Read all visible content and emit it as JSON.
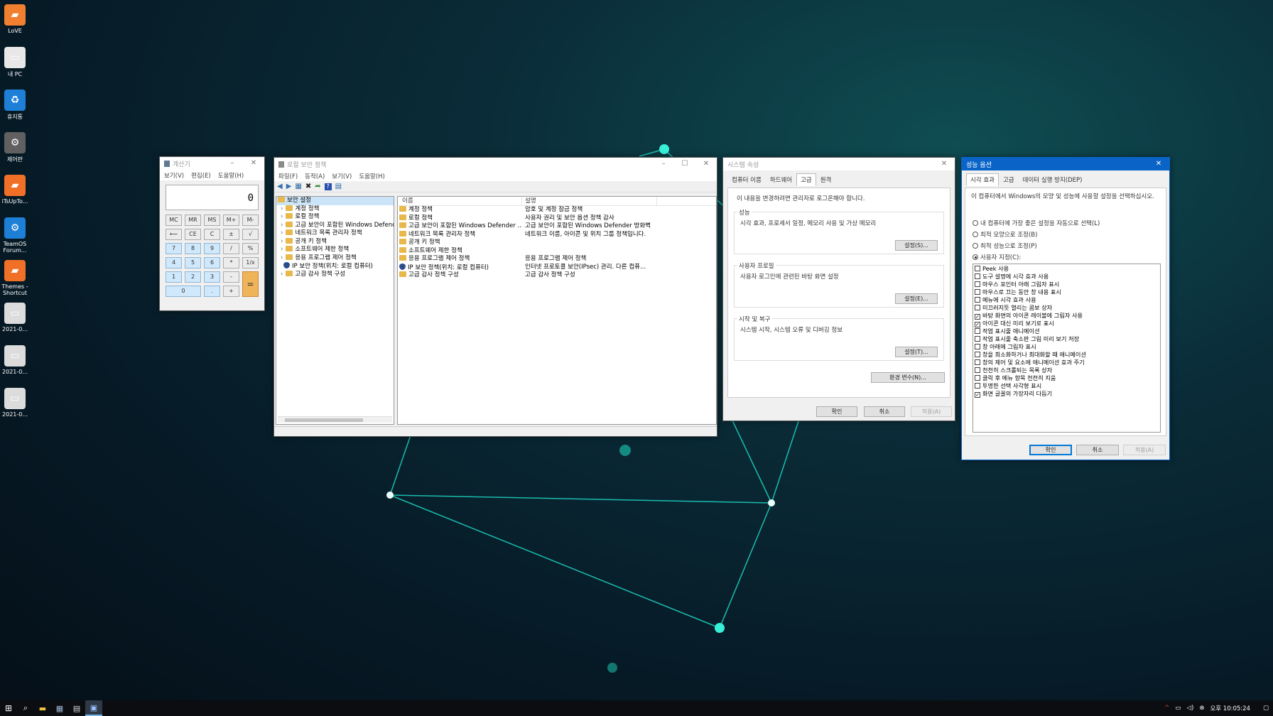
{
  "desktop": {
    "icons": [
      {
        "label": "LoVE",
        "color": "#f08030",
        "glyph": "▰"
      },
      {
        "label": "내 PC",
        "color": "#e8e8e8",
        "glyph": "▭"
      },
      {
        "label": "휴지통",
        "color": "#1e7fd6",
        "glyph": "♻"
      },
      {
        "label": "제어판",
        "color": "#606060",
        "glyph": "⚙"
      },
      {
        "label": "iTsUpTo...",
        "color": "#f07028",
        "glyph": "▰"
      },
      {
        "label": "TeamOS Forum...",
        "color": "#1e7fd6",
        "glyph": "⚙"
      },
      {
        "label": "Themes - Shortcut",
        "color": "#f07028",
        "glyph": "▰"
      },
      {
        "label": "2021-0...",
        "color": "#dcdcdc",
        "glyph": "▭"
      },
      {
        "label": "2021-0...",
        "color": "#dcdcdc",
        "glyph": "▭"
      },
      {
        "label": "2021-0...",
        "color": "#dcdcdc",
        "glyph": "▭"
      }
    ]
  },
  "calculator": {
    "title": "계산기",
    "menu": [
      "보기(V)",
      "편집(E)",
      "도움말(H)"
    ],
    "display": "0",
    "buttons": [
      "MC",
      "MR",
      "MS",
      "M+",
      "M-",
      "⟵",
      "CE",
      "C",
      "±",
      "√",
      "7",
      "8",
      "9",
      "/",
      "%",
      "4",
      "5",
      "6",
      "*",
      "1/x",
      "1",
      "2",
      "3",
      "-",
      "=",
      "0",
      ".",
      "+"
    ]
  },
  "secpol": {
    "title": "로컬 보안 정책",
    "menu": [
      "파일(F)",
      "동작(A)",
      "보기(V)",
      "도움말(H)"
    ],
    "tree_root": "보안 설정",
    "tree": [
      "계정 정책",
      "로컬 정책",
      "고급 보안이 포함된 Windows Defenc",
      "네트워크 목록 관리자 정책",
      "공개 키 정책",
      "소프트웨어 제한 정책",
      "응용 프로그램 제어 정책",
      "IP 보안 정책(위치: 로컬 컴퓨터)",
      "고급 감사 정책 구성"
    ],
    "columns": [
      "이름",
      "설명"
    ],
    "rows": [
      {
        "name": "계정 정책",
        "desc": "암호 및 계정 잠금 정책"
      },
      {
        "name": "로컬 정책",
        "desc": "사용자 권리 및 보안 옵션 정책 감사"
      },
      {
        "name": "고급 보안이 포함된 Windows Defender ...",
        "desc": "고급 보안이 포함된 Windows Defender 방화벽"
      },
      {
        "name": "네트워크 목록 관리자 정책",
        "desc": "네트워크 이름, 아이콘 및 위치 그룹 정책입니다."
      },
      {
        "name": "공개 키 정책",
        "desc": ""
      },
      {
        "name": "소프트웨어 제한 정책",
        "desc": ""
      },
      {
        "name": "응용 프로그램 제어 정책",
        "desc": "응용 프로그램 제어 정책"
      },
      {
        "name": "IP 보안 정책(위치: 로컬 컴퓨터)",
        "desc": "인터넷 프로토콜 보안(IPsec) 관리. 다른 컴퓨..."
      },
      {
        "name": "고급 감사 정책 구성",
        "desc": "고급 감사 정책 구성"
      }
    ]
  },
  "sysprops": {
    "title": "시스템 속성",
    "tabs": [
      "컴퓨터 이름",
      "하드웨어",
      "고급",
      "원격"
    ],
    "admin_note": "이 내용을 변경하려면 관리자로 로그온해야 합니다.",
    "perf_label": "성능",
    "perf_desc": "시각 효과, 프로세서 일정, 메모리 사용 및 가상 메모리",
    "perf_btn": "설정(S)...",
    "profile_label": "사용자 프로필",
    "profile_desc": "사용자 로그인에 관련된 바탕 화면 설정",
    "profile_btn": "설정(E)...",
    "startup_label": "시작 및 복구",
    "startup_desc": "시스템 시작, 시스템 오류 및 디버깅 정보",
    "startup_btn": "설정(T)...",
    "env_btn": "환경 변수(N)...",
    "ok": "확인",
    "cancel": "취소",
    "apply": "적용(A)"
  },
  "perfopts": {
    "title": "성능 옵션",
    "tabs": [
      "시각 효과",
      "고급",
      "데이터 실행 방지(DEP)"
    ],
    "intro": "이 컴퓨터에서 Windows의 모양 및 성능에 사용할 설정을 선택하십시오.",
    "radios": [
      {
        "label": "내 컴퓨터에 가장 좋은 설정을 자동으로 선택(L)",
        "on": false
      },
      {
        "label": "최적 모양으로 조정(B)",
        "on": false
      },
      {
        "label": "최적 성능으로 조정(P)",
        "on": false
      },
      {
        "label": "사용자 지정(C):",
        "on": true
      }
    ],
    "effects": [
      {
        "label": "Peek 사용",
        "on": false
      },
      {
        "label": "도구 설명에 시각 효과 사용",
        "on": false
      },
      {
        "label": "마우스 포인터 아래 그림자 표시",
        "on": false
      },
      {
        "label": "마우스로 끄는 동안 창 내용 표시",
        "on": false
      },
      {
        "label": "메뉴에 시각 효과 사용",
        "on": false
      },
      {
        "label": "미끄러지듯 열리는 콤보 상자",
        "on": false
      },
      {
        "label": "바탕 화면의 아이콘 레이블에 그림자 사용",
        "on": true
      },
      {
        "label": "아이콘 대신 미리 보기로 표시",
        "on": true
      },
      {
        "label": "작업 표시줄 애니메이션",
        "on": false
      },
      {
        "label": "작업 표시줄 축소판 그림 미리 보기 저장",
        "on": false
      },
      {
        "label": "창 아래에 그림자 표시",
        "on": false
      },
      {
        "label": "창을 최소화하거나 최대화할 때 애니메이션",
        "on": false
      },
      {
        "label": "창의 제어 및 요소에 애니메이션 효과 주기",
        "on": false
      },
      {
        "label": "천천히 스크롤되는 목록 상자",
        "on": false
      },
      {
        "label": "클릭 후 메뉴 항목 천천히 지움",
        "on": false
      },
      {
        "label": "투명한 선택 사각형 표시",
        "on": false
      },
      {
        "label": "화면 글꼴의 가장자리 다듬기",
        "on": true
      }
    ],
    "ok": "확인",
    "cancel": "취소",
    "apply": "적용(A)"
  },
  "taskbar": {
    "time": "오후 10:05:24"
  }
}
